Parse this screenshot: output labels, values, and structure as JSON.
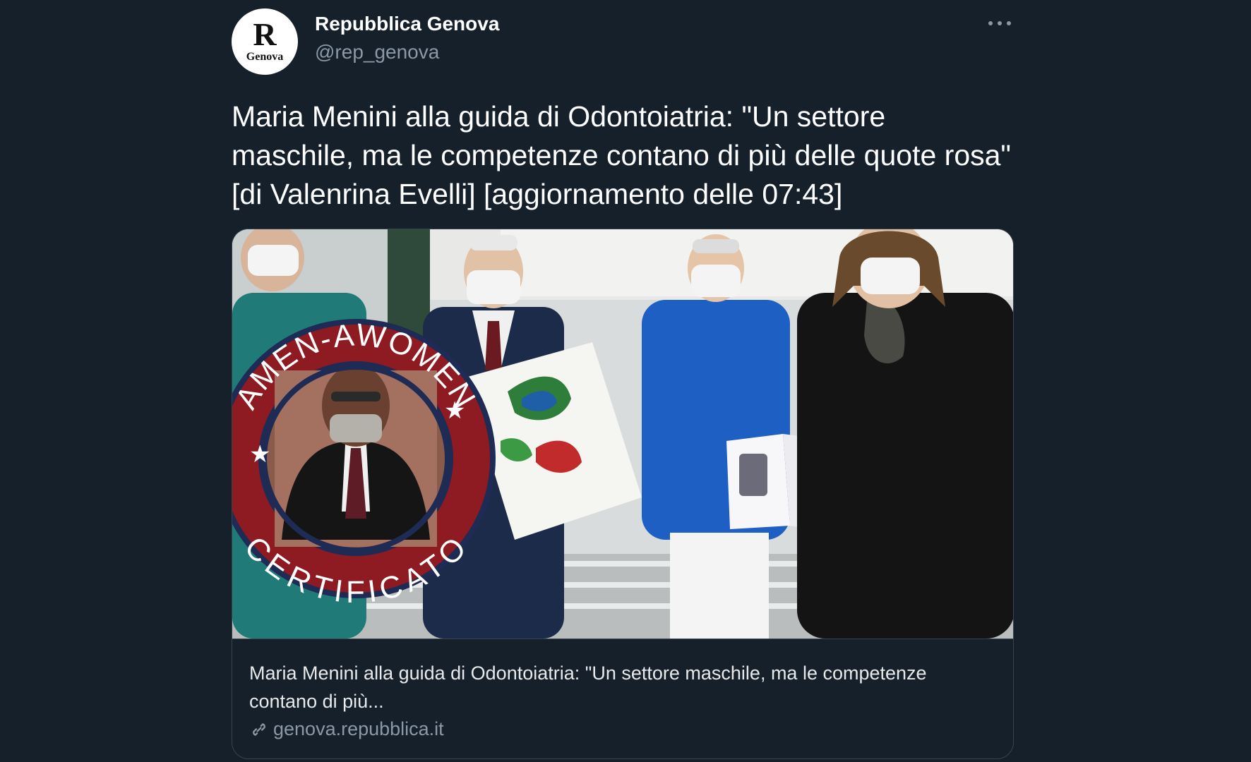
{
  "account": {
    "avatar_monogram": "R",
    "avatar_city": "Genova",
    "display_name": "Repubblica Genova",
    "handle": "@rep_genova"
  },
  "tweet": {
    "text": "Maria Menini alla guida di Odontoiatria: \"Un settore maschile, ma le competenze contano di più delle quote rosa\" [di Valenrina Evelli] [aggiornamento delle 07:43]"
  },
  "card": {
    "image_icon": "photo-with-sticker",
    "sticker": {
      "top_text": "AMEN-AWOMEN",
      "bottom_text": "CERTIFICATO",
      "ring_color": "#8e1b22"
    },
    "title": "Maria Menini alla guida di Odontoiatria: \"Un settore maschile, ma le competenze contano di più...",
    "domain": "genova.repubblica.it",
    "domain_icon": "link-icon"
  },
  "more_icon": "more-horizontal-icon",
  "colors": {
    "background": "#15202b",
    "text_primary": "#ffffff",
    "text_secondary": "#8b98a5",
    "border": "#38444d"
  }
}
